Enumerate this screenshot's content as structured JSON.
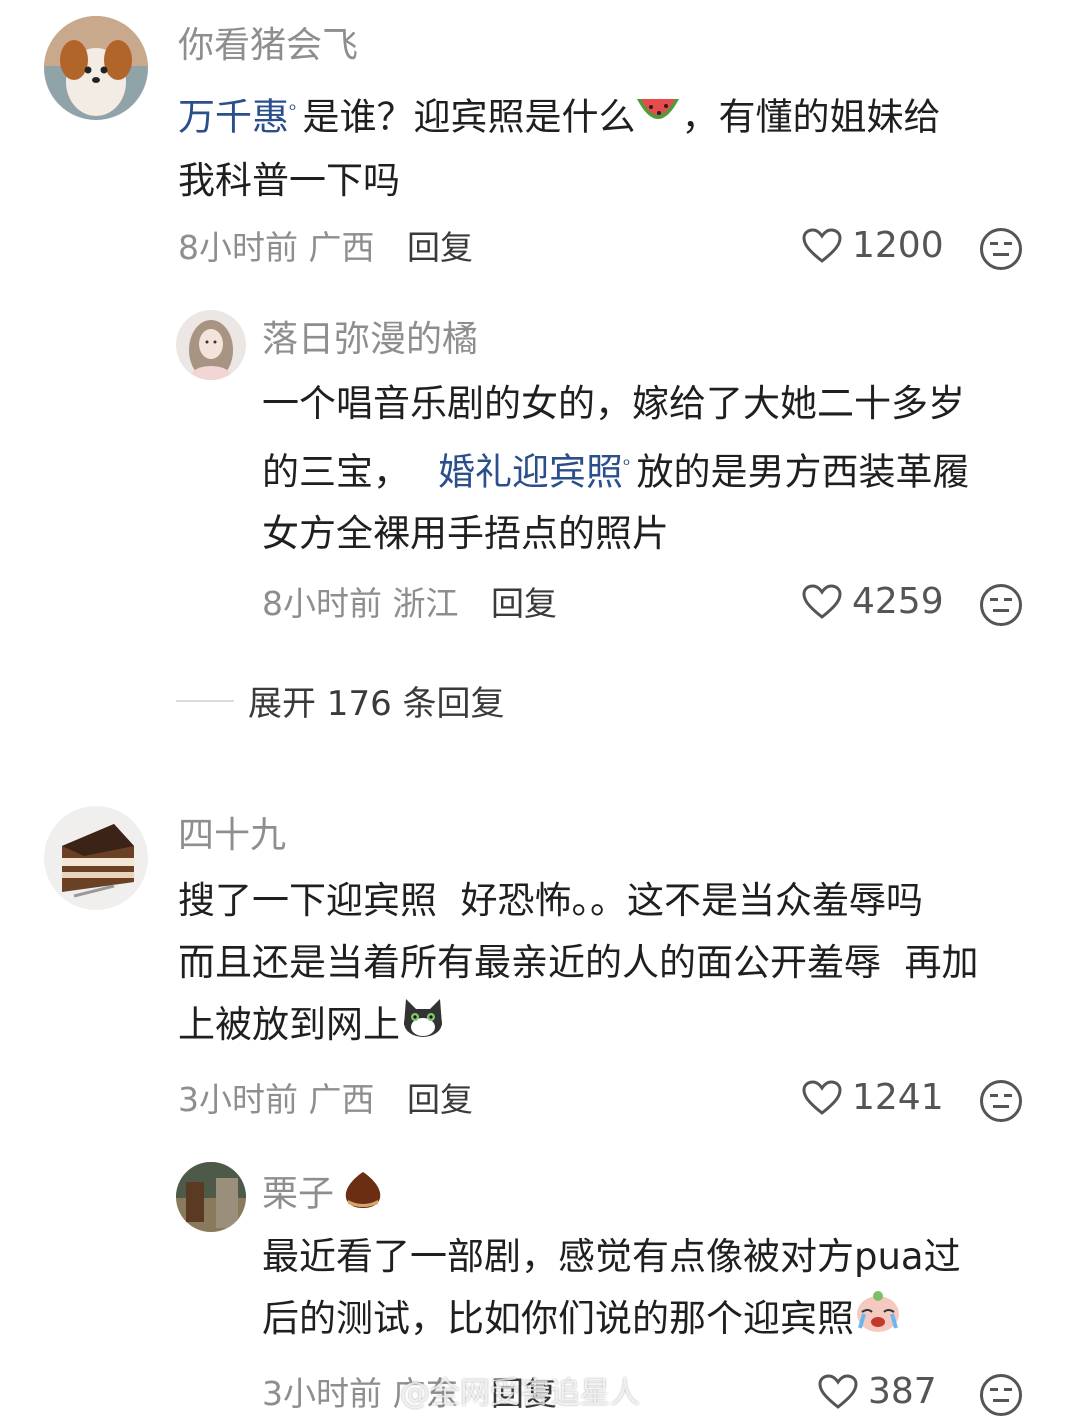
{
  "comments": [
    {
      "user": "你看猪会飞",
      "link": "万千惠",
      "text_a": "是谁？迎宾照是什么",
      "text_b": "，有懂的姐妹给",
      "text_c": "我科普一下吗",
      "time": "8小时前",
      "region": "广西",
      "reply_label": "回复",
      "likes": "1200",
      "replies": [
        {
          "user": "落日弥漫的橘",
          "text_a": "一个唱音乐剧的女的，嫁给了大她二十多岁",
          "text_b": "的三宝，",
          "link": "婚礼迎宾照",
          "text_c": "放的是男方西装革履",
          "text_d": "女方全裸用手捂点的照片",
          "time": "8小时前",
          "region": "浙江",
          "reply_label": "回复",
          "likes": "4259"
        }
      ],
      "expand_label": "展开 176 条回复"
    },
    {
      "user": "四十九",
      "text_a": "搜了一下迎宾照  好恐怖。。这不是当众羞辱吗",
      "text_b": "而且还是当着所有最亲近的人的面公开羞辱  再加",
      "text_c": "上被放到网上",
      "time": "3小时前",
      "region": "广西",
      "reply_label": "回复",
      "likes": "1241",
      "replies": [
        {
          "user": "栗子",
          "text_a": "最近看了一部剧，感觉有点像被对方pua过",
          "text_b": "后的测试，比如你们说的那个迎宾照",
          "time": "3小时前",
          "region": "广东",
          "reply_label": "回复",
          "likes": "387"
        }
      ]
    }
  ],
  "watermark": "@全网受害追星人",
  "icons": {
    "like": "heart-outline-icon",
    "react": "neutral-face-icon",
    "search_hint": "search-hint-icon"
  }
}
